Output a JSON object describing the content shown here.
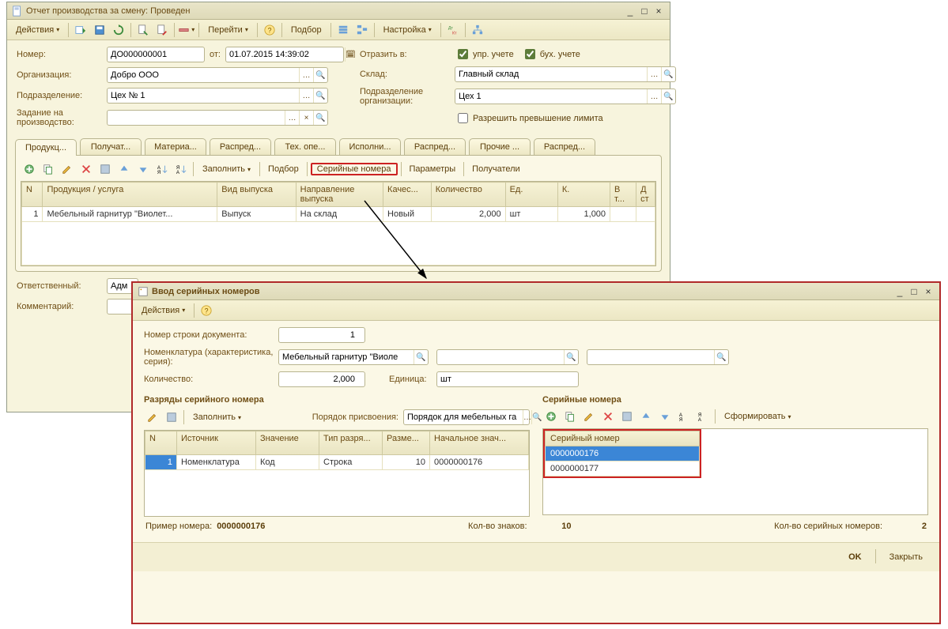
{
  "main": {
    "title": "Отчет производства за смену: Проведен",
    "actions_label": "Действия",
    "goto_label": "Перейти",
    "podbor_label": "Подбор",
    "settings_label": "Настройка",
    "labels": {
      "number": "Номер:",
      "from": "от:",
      "org": "Организация:",
      "dept": "Подразделение:",
      "task": "Задание на производство:",
      "reflect": "Отразить в:",
      "upr": "упр. учете",
      "buh": "бух. учете",
      "warehouse": "Склад:",
      "orgdept": "Подразделение организации:",
      "allow_excess": "Разрешить превышение лимита",
      "responsible": "Ответственный:",
      "comment": "Комментарий:"
    },
    "values": {
      "number": "ДО000000001",
      "date": "01.07.2015 14:39:02",
      "org": "Добро ООО",
      "dept": "Цех № 1",
      "task": "",
      "warehouse": "Главный склад",
      "orgdept": "Цех 1",
      "responsible": "Адм",
      "comment": ""
    },
    "tabs": [
      "Продукц...",
      "Получат...",
      "Материа...",
      "Распред...",
      "Тех. опе...",
      "Исполни...",
      "Распред...",
      "Прочие ...",
      "Распред..."
    ],
    "subtoolbar": {
      "fill": "Заполнить",
      "podbor": "Подбор",
      "serials": "Серийные номера",
      "params": "Параметры",
      "recipients": "Получатели"
    },
    "grid": {
      "headers": [
        "N",
        "Продукция / услуга",
        "Вид выпуска",
        "Направление выпуска",
        "Качес...",
        "Количество",
        "Ед.",
        "К.",
        "В т...",
        "Д ст"
      ],
      "row": {
        "n": "1",
        "product": "Мебельный гарнитур \"Виолет...",
        "type": "Выпуск",
        "direction": "На склад",
        "quality": "Новый",
        "qty": "2,000",
        "unit": "шт",
        "k": "1,000"
      }
    }
  },
  "dialog": {
    "title": "Ввод серийных номеров",
    "actions_label": "Действия",
    "labels": {
      "doc_line": "Номер строки документа:",
      "nomenclature": "Номенклатура (характеристика, серия):",
      "qty": "Количество:",
      "unit": "Единица:",
      "digits_title": "Разряды серийного номера",
      "serials_title": "Серийные номера",
      "fill": "Заполнить",
      "order": "Порядок присвоения:",
      "form": "Сформировать",
      "example": "Пример номера:",
      "sign_count": "Кол-во знаков:",
      "serial_count": "Кол-во серийных номеров:"
    },
    "values": {
      "doc_line": "1",
      "nomenclature": "Мебельный гарнитур \"Виоле",
      "qty": "2,000",
      "unit": "шт",
      "order": "Порядок для мебельных га",
      "example": "0000000176",
      "sign_count": "10",
      "serial_count": "2"
    },
    "digits_grid": {
      "headers": [
        "N",
        "Источник",
        "Значение",
        "Тип разря...",
        "Разме...",
        "Начальное знач..."
      ],
      "row": {
        "n": "1",
        "source": "Номенклатура",
        "value": "Код",
        "type": "Строка",
        "size": "10",
        "start": "0000000176"
      }
    },
    "serials_grid": {
      "header": "Серийный номер",
      "rows": [
        "0000000176",
        "0000000177"
      ]
    },
    "buttons": {
      "ok": "OK",
      "close": "Закрыть"
    }
  }
}
